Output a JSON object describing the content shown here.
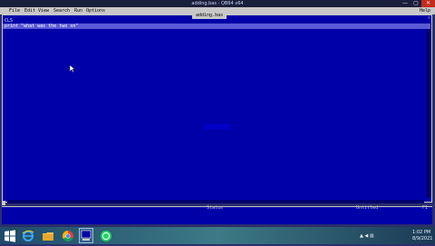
{
  "window": {
    "title": "adding.bas - QB64 x64"
  },
  "menu": {
    "items": [
      "File",
      "Edit",
      "View",
      "Search",
      "Run",
      "Options"
    ],
    "help": "Help"
  },
  "editor": {
    "file_tab": "adding.bas",
    "lines": [
      "CLS",
      "print \"what was the two sn\""
    ]
  },
  "status": {
    "label": "Status",
    "right": "Untitled",
    "f1": "F1"
  },
  "taskbar": {
    "tray": "▲ ◀ ▥",
    "time": "1:02 PM",
    "date": "8/9/2021"
  },
  "colors": {
    "editor_bg": "#0000a8",
    "menu_bg": "#c8c8c8",
    "close_btn": "#c42b1c"
  }
}
